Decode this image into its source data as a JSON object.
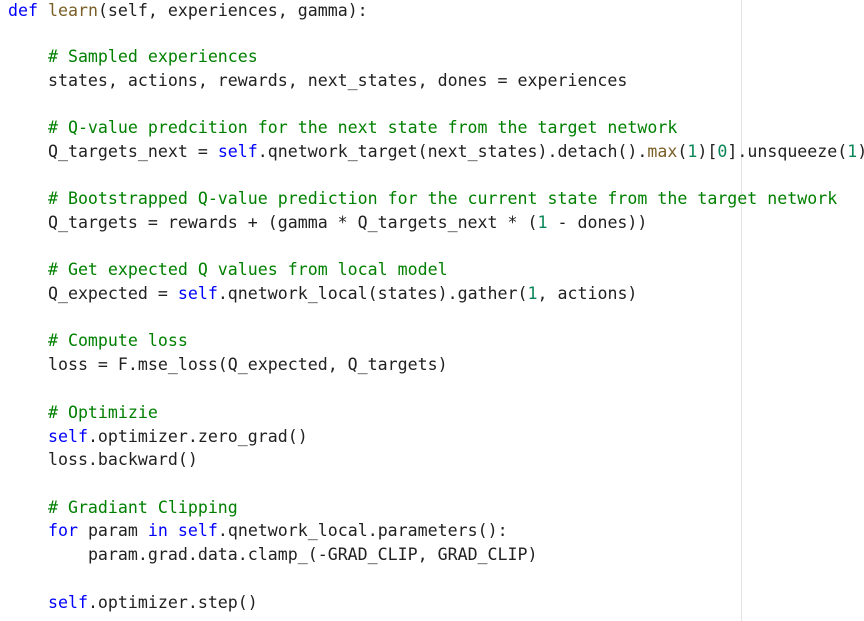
{
  "editor": {
    "language": "python",
    "colors": {
      "keyword": "#0000ff",
      "function_name": "#795e26",
      "comment": "#008000",
      "number": "#098658",
      "text": "#212121"
    },
    "lines": [
      {
        "indent": "",
        "tokens": [
          [
            "kw",
            "def"
          ],
          [
            "t",
            " "
          ],
          [
            "fn",
            "learn"
          ],
          [
            "t",
            "(self, experiences, gamma):"
          ]
        ]
      },
      {
        "indent": "    ",
        "tokens": [
          [
            "cm",
            "# Sampled experiences"
          ]
        ]
      },
      {
        "indent": "    ",
        "tokens": [
          [
            "t",
            "states, actions, rewards, next_states, dones = experiences"
          ]
        ]
      },
      {
        "indent": "    ",
        "tokens": [
          [
            "cm",
            "# Q-value predcition for the next state from the target network"
          ]
        ]
      },
      {
        "indent": "    ",
        "tokens": [
          [
            "t",
            "Q_targets_next = "
          ],
          [
            "kw",
            "self"
          ],
          [
            "t",
            ".qnetwork_target(next_states).detach()."
          ],
          [
            "bi",
            "max"
          ],
          [
            "t",
            "("
          ],
          [
            "num",
            "1"
          ],
          [
            "t",
            ")["
          ],
          [
            "num",
            "0"
          ],
          [
            "t",
            "].unsqueeze("
          ],
          [
            "num",
            "1"
          ],
          [
            "t",
            ")"
          ]
        ]
      },
      {
        "indent": "    ",
        "tokens": [
          [
            "cm",
            "# Bootstrapped Q-value prediction for the current state from the target network"
          ]
        ]
      },
      {
        "indent": "    ",
        "tokens": [
          [
            "t",
            "Q_targets = rewards + (gamma * Q_targets_next * ("
          ],
          [
            "num",
            "1"
          ],
          [
            "t",
            " - dones))"
          ]
        ]
      },
      {
        "indent": "    ",
        "tokens": [
          [
            "cm",
            "# Get expected Q values from local model"
          ]
        ]
      },
      {
        "indent": "    ",
        "tokens": [
          [
            "t",
            "Q_expected = "
          ],
          [
            "kw",
            "self"
          ],
          [
            "t",
            ".qnetwork_local(states).gather("
          ],
          [
            "num",
            "1"
          ],
          [
            "t",
            ", actions)"
          ]
        ]
      },
      {
        "indent": "    ",
        "tokens": [
          [
            "cm",
            "# Compute loss"
          ]
        ]
      },
      {
        "indent": "    ",
        "tokens": [
          [
            "t",
            "loss = F.mse_loss(Q_expected, Q_targets)"
          ]
        ]
      },
      {
        "indent": "    ",
        "tokens": [
          [
            "cm",
            "# Optimizie"
          ]
        ]
      },
      {
        "indent": "    ",
        "tokens": [
          [
            "kw",
            "self"
          ],
          [
            "t",
            ".optimizer.zero_grad()"
          ]
        ]
      },
      {
        "indent": "    ",
        "tokens": [
          [
            "t",
            "loss.backward()"
          ]
        ]
      },
      {
        "indent": "    ",
        "tokens": [
          [
            "cm",
            "# Gradiant Clipping"
          ]
        ]
      },
      {
        "indent": "    ",
        "tokens": [
          [
            "kw",
            "for"
          ],
          [
            "t",
            " param "
          ],
          [
            "kw",
            "in"
          ],
          [
            "t",
            " "
          ],
          [
            "kw",
            "self"
          ],
          [
            "t",
            ".qnetwork_local.parameters():"
          ]
        ]
      },
      {
        "indent": "        ",
        "tokens": [
          [
            "t",
            "param.grad.data.clamp_(-GRAD_CLIP, GRAD_CLIP)"
          ]
        ]
      },
      {
        "indent": "    ",
        "tokens": [
          [
            "kw",
            "self"
          ],
          [
            "t",
            ".optimizer.step()"
          ]
        ]
      }
    ]
  }
}
